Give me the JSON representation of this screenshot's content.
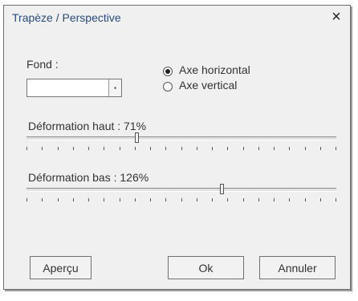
{
  "dialog": {
    "title": "Trapèze / Perspective",
    "close_glyph": "×"
  },
  "fond": {
    "label": "Fond :",
    "value": ""
  },
  "axis": {
    "options": [
      "Axe horizontal",
      "Axe vertical"
    ],
    "selected": "Axe horizontal"
  },
  "deformation_haut": {
    "label": "Déformation haut : 71%",
    "value_percent": 71
  },
  "deformation_bas": {
    "label": "Déformation bas : 126%",
    "value_percent": 126
  },
  "buttons": {
    "preview": "Aperçu",
    "ok": "Ok",
    "cancel": "Annuler"
  },
  "icons": [
    "close-icon",
    "dropdown-arrow-icon"
  ]
}
